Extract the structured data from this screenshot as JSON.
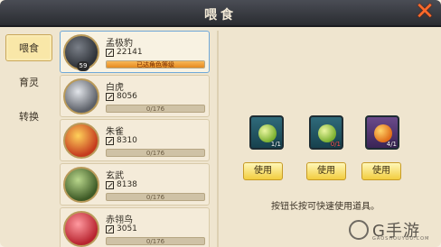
{
  "header": {
    "title": "喂食"
  },
  "sidebar": {
    "tabs": [
      {
        "label": "喂食",
        "active": true
      },
      {
        "label": "育灵",
        "active": false
      },
      {
        "label": "转换",
        "active": false
      }
    ]
  },
  "pets": [
    {
      "name": "孟极豹",
      "level": "59",
      "power": "22141",
      "bar_text": "已达角色等级",
      "bar_fill_fraction": 1.0
    },
    {
      "name": "白虎",
      "level": "",
      "power": "8056",
      "bar_text": "0/176",
      "bar_fill_fraction": 0
    },
    {
      "name": "朱雀",
      "level": "",
      "power": "8310",
      "bar_text": "0/176",
      "bar_fill_fraction": 0
    },
    {
      "name": "玄武",
      "level": "",
      "power": "8138",
      "bar_text": "0/176",
      "bar_fill_fraction": 0
    },
    {
      "name": "赤翎鸟",
      "level": "",
      "power": "3051",
      "bar_text": "0/176",
      "bar_fill_fraction": 0
    }
  ],
  "items": [
    {
      "count": "1/1",
      "use_label": "使用"
    },
    {
      "count": "0/1",
      "use_label": "使用"
    },
    {
      "count": "4/1",
      "use_label": "使用"
    }
  ],
  "hint": "按钮长按可快速使用道具。",
  "watermark": {
    "text": "G手游",
    "sub": "GAOSHOUYOU.COM"
  },
  "colors": {
    "accent_orange": "#ff6a2a",
    "button_yellow": "#f2cd3f",
    "selected_border": "#6fa8d8"
  }
}
